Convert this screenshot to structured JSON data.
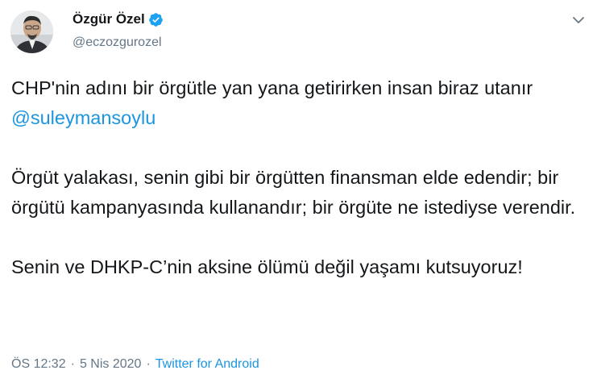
{
  "author": {
    "display_name": "Özgür Özel",
    "handle": "@eczozgurozel",
    "verified_icon": "verified-badge-icon",
    "avatar_icon": "profile-photo"
  },
  "menu_icon": "chevron-down-icon",
  "tweet": {
    "p1_text": "CHP'nin adını bir örgütle yan yana getirirken insan biraz utanır ",
    "p1_mention": "@suleymansoylu",
    "p2_text": "Örgüt yalakası, senin gibi bir örgütten finansman elde edendir; bir örgütü kampanyasında kullanandır; bir örgüte ne istediyse verendir.",
    "p3_text": "Senin ve DHKP-C’nin aksine ölümü değil yaşamı kutsuyoruz!"
  },
  "meta": {
    "time": "ÖS 12:32",
    "date": "5 Nis 2020",
    "separator": "·",
    "source": "Twitter for Android"
  },
  "colors": {
    "text": "#14171a",
    "secondary": "#657786",
    "link": "#1b95e0",
    "verified": "#1da1f2"
  }
}
